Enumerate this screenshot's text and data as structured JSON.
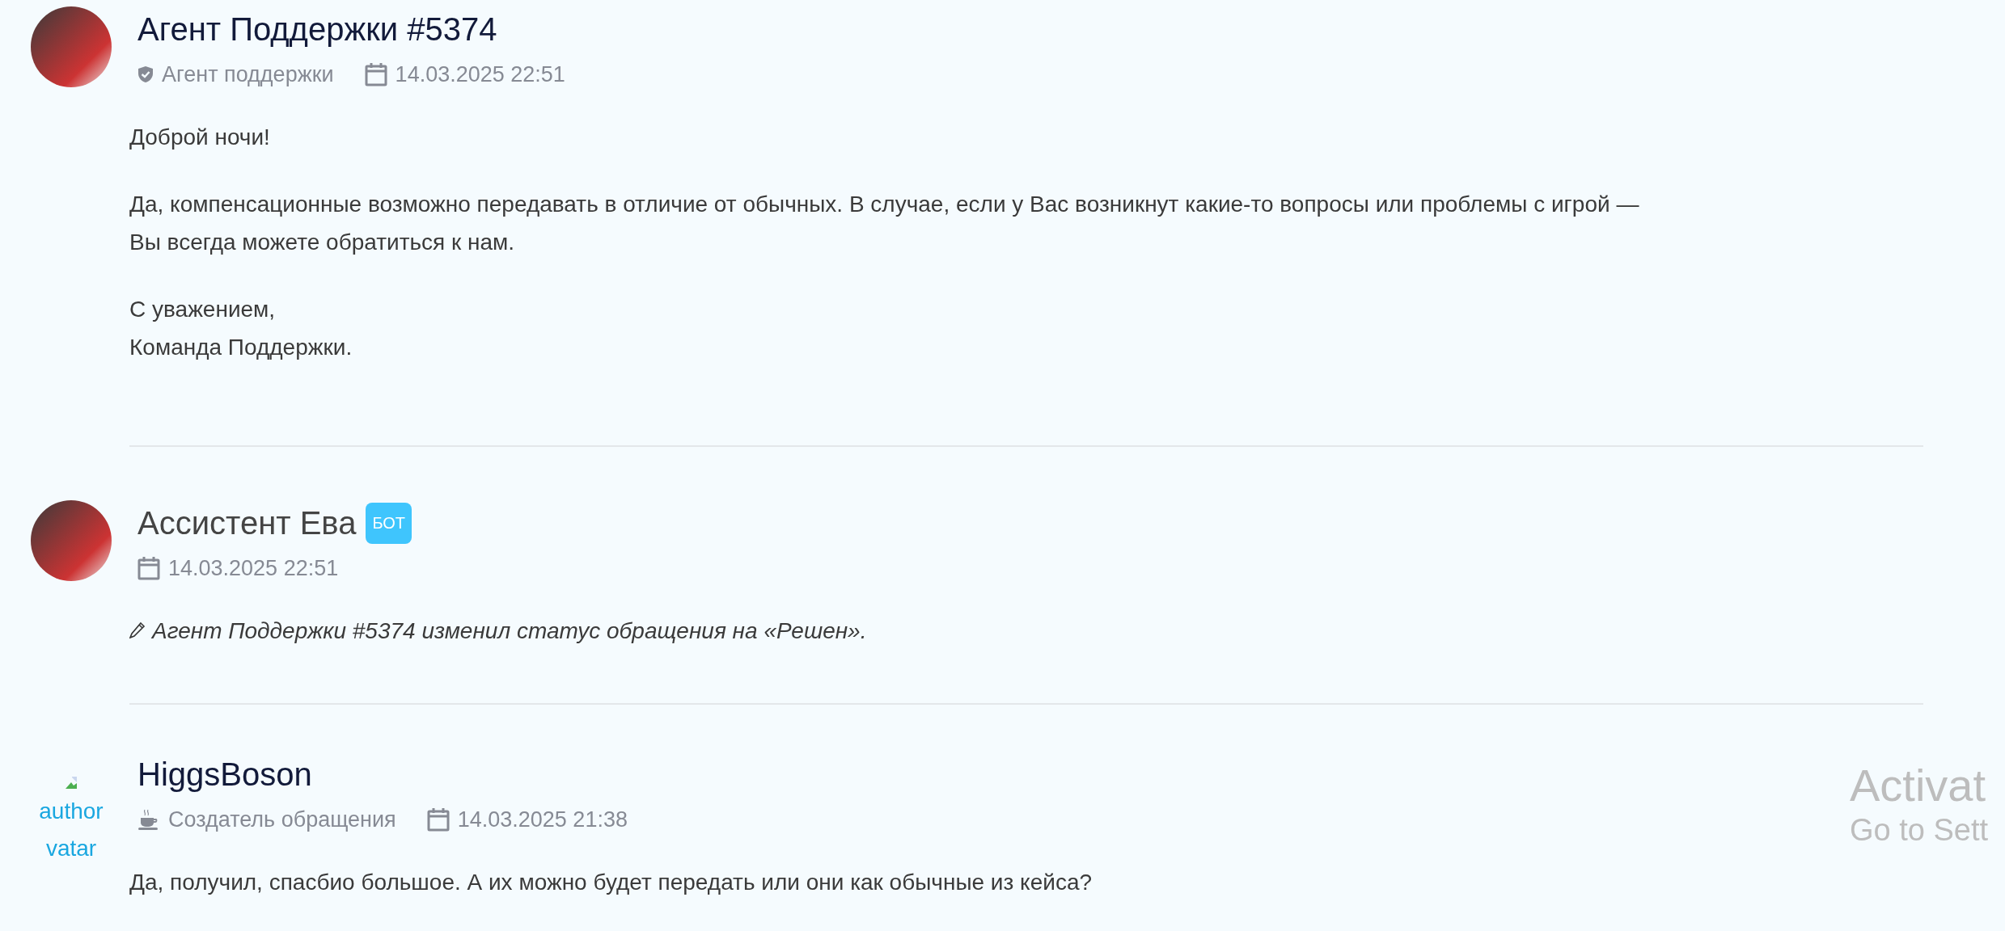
{
  "posts": [
    {
      "author": "Агент Поддержки #5374",
      "kind": "person",
      "avatar": {
        "kind": "image"
      },
      "role": {
        "kind": "agent",
        "label": "Агент поддержки"
      },
      "date": "14.03.2025 22:51",
      "body": [
        {
          "kind": "text",
          "lines": [
            "Доброй ночи!"
          ]
        },
        {
          "kind": "text",
          "lines": [
            "Да, компенсационные возможно передавать в отличие от обычных. В случае, если у Вас возникнут какие-то вопросы или проблемы с игрой —",
            "Вы всегда можете обратиться к нам."
          ]
        },
        {
          "kind": "text",
          "lines": [
            "С уважением,",
            "Команда Поддержки."
          ]
        }
      ]
    },
    {
      "author": "Ассистент Ева",
      "kind": "bot",
      "badge": "БОТ",
      "avatar": {
        "kind": "image"
      },
      "date": "14.03.2025 22:51",
      "body": [
        {
          "kind": "event",
          "lines": [
            "Агент Поддержки #5374 изменил статус обращения на «Решен»."
          ]
        }
      ]
    },
    {
      "author": "HiggsBoson",
      "kind": "person",
      "avatar": {
        "kind": "broken",
        "alt_lines": [
          "author",
          "vatar"
        ]
      },
      "role": {
        "kind": "creator",
        "label": "Создатель обращения"
      },
      "date": "14.03.2025 21:38",
      "body": [
        {
          "kind": "text",
          "lines": [
            "Да, получил, спасбио большое. А их можно будет передать или они как обычные из кейса?"
          ]
        }
      ]
    }
  ],
  "os_overlay": {
    "title": "Activat",
    "subtitle": "Go to Sett"
  }
}
